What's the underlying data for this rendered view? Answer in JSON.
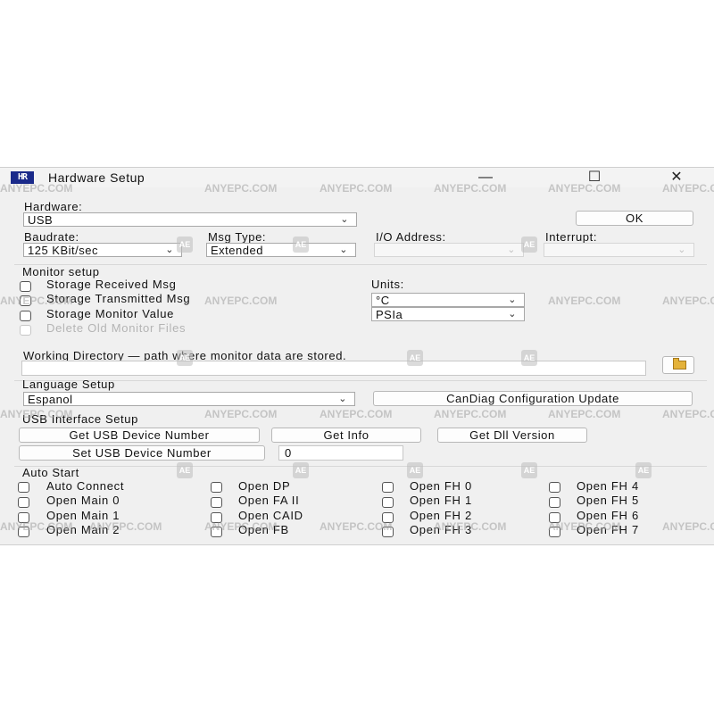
{
  "window": {
    "app_icon_text": "HR",
    "title": "Hardware Setup",
    "minimize_glyph": "—",
    "maximize_glyph": "☐",
    "close_glyph": "✕"
  },
  "hardware": {
    "label": "Hardware:",
    "value": "USB",
    "ok_label": "OK"
  },
  "baudrate": {
    "label": "Baudrate:",
    "value": "125 KBit/sec"
  },
  "msg_type": {
    "label": "Msg Type:",
    "value": "Extended"
  },
  "io_address": {
    "label": "I/O Address:",
    "value": ""
  },
  "interrupt": {
    "label": "Interrupt:",
    "value": ""
  },
  "monitor": {
    "title": "Monitor setup",
    "options": [
      {
        "label": "Storage Received Msg",
        "checked": false,
        "enabled": true
      },
      {
        "label": "Storage Transmitted Msg",
        "checked": false,
        "enabled": true
      },
      {
        "label": "Storage Monitor Value",
        "checked": false,
        "enabled": true
      },
      {
        "label": "Delete Old Monitor Files",
        "checked": false,
        "enabled": false
      }
    ],
    "units_label": "Units:",
    "temp_unit": "°C",
    "pressure_unit": "PSIa",
    "working_dir_label": "Working Directory — path where monitor data are stored.",
    "working_dir_value": ""
  },
  "language": {
    "title": "Language Setup",
    "value": "Espanol",
    "config_update_label": "CanDiag Configuration Update"
  },
  "usb": {
    "title": "USB Interface Setup",
    "get_device_number_label": "Get USB Device Number",
    "get_info_label": "Get Info",
    "get_dll_version_label": "Get Dll Version",
    "set_device_number_label": "Set USB Device Number",
    "device_number_value": "0"
  },
  "auto_start": {
    "title": "Auto Start",
    "items": [
      {
        "label": "Auto Connect",
        "checked": false
      },
      {
        "label": "Open DP",
        "checked": false
      },
      {
        "label": "Open FH 0",
        "checked": false
      },
      {
        "label": "Open FH 4",
        "checked": false
      },
      {
        "label": "Open Main 0",
        "checked": false
      },
      {
        "label": "Open FA II",
        "checked": false
      },
      {
        "label": "Open FH 1",
        "checked": false
      },
      {
        "label": "Open FH 5",
        "checked": false
      },
      {
        "label": "Open Main 1",
        "checked": false
      },
      {
        "label": "Open CAID",
        "checked": false
      },
      {
        "label": "Open FH 2",
        "checked": false
      },
      {
        "label": "Open FH 6",
        "checked": false
      },
      {
        "label": "Open Main 2",
        "checked": false
      },
      {
        "label": "Open FB",
        "checked": false
      },
      {
        "label": "Open FH 3",
        "checked": false
      },
      {
        "label": "Open FH 7",
        "checked": false
      }
    ]
  },
  "watermark": {
    "text": "ANYEPC.COM",
    "logo_text": "AE"
  }
}
